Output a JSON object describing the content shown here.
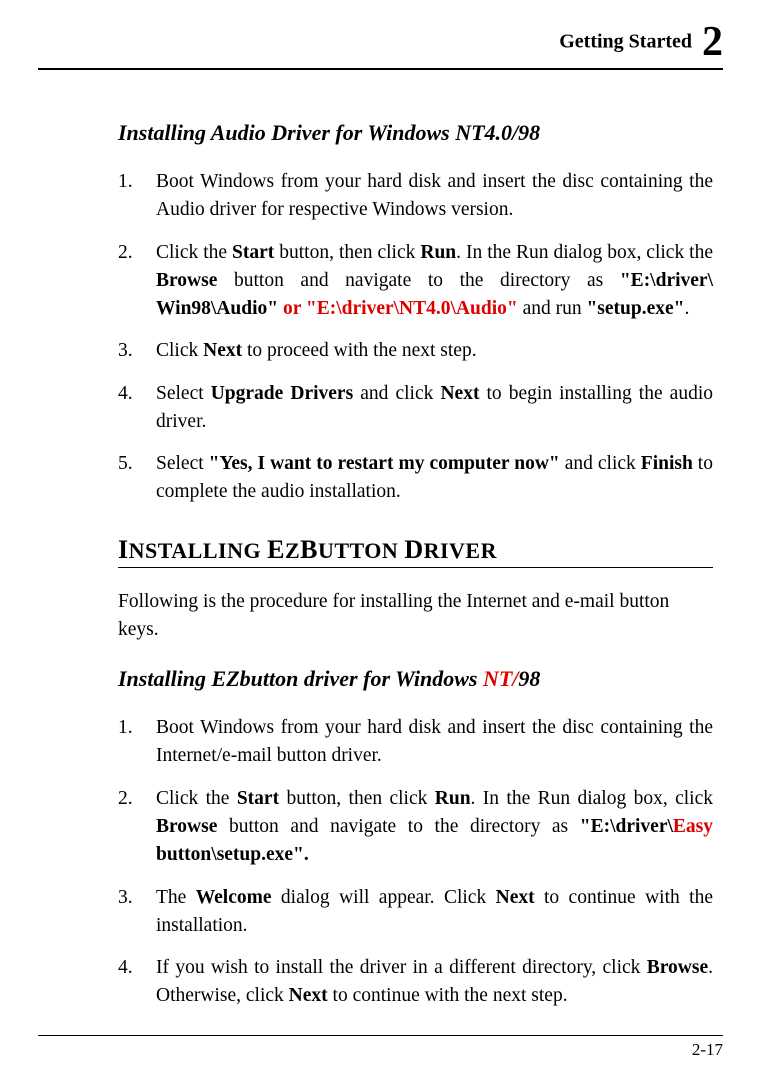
{
  "header": {
    "label": "Getting Started",
    "chapter": "2"
  },
  "sectionA": {
    "title_pre": "Installing Audio Driver for Windows NT4.0/",
    "title_red": "",
    "title_post": "98",
    "items": [
      {
        "parts": [
          {
            "t": "Boot Windows from your hard disk and insert the disc containing the Audio driver for respective Windows version."
          }
        ]
      },
      {
        "parts": [
          {
            "t": "Click the "
          },
          {
            "t": "Start",
            "b": true
          },
          {
            "t": " button, then click "
          },
          {
            "t": "Run",
            "b": true
          },
          {
            "t": ". In the Run dialog box, click the "
          },
          {
            "t": "Browse",
            "b": true
          },
          {
            "t": " button and navigate to the directory as "
          },
          {
            "t": "\"E:\\driver\\ Win98\\Audio\"",
            "b": true
          },
          {
            "t": " "
          },
          {
            "t": "or \"E:\\driver\\NT4.0\\Audio\"",
            "b": true,
            "red": true
          },
          {
            "t": " and run "
          },
          {
            "t": "\"setup.exe\"",
            "b": true
          },
          {
            "t": "."
          }
        ]
      },
      {
        "parts": [
          {
            "t": "Click "
          },
          {
            "t": "Next",
            "b": true
          },
          {
            "t": " to proceed with the next step."
          }
        ]
      },
      {
        "parts": [
          {
            "t": "Select "
          },
          {
            "t": "Upgrade Drivers",
            "b": true
          },
          {
            "t": " and click "
          },
          {
            "t": "Next",
            "b": true
          },
          {
            "t": " to begin installing the audio driver."
          }
        ]
      },
      {
        "parts": [
          {
            "t": "Select "
          },
          {
            "t": "\"Yes, I want to restart my computer now\"",
            "b": true
          },
          {
            "t": " and click "
          },
          {
            "t": "Finish",
            "b": true
          },
          {
            "t": " to complete the audio installation."
          }
        ]
      }
    ]
  },
  "sectionB": {
    "heading": "Installing EzButton Driver",
    "intro": "Following is the procedure for installing the Internet and e-mail button keys.",
    "sub_pre": "Installing EZbutton driver for Windows ",
    "sub_red": "NT/",
    "sub_post": "98",
    "items": [
      {
        "parts": [
          {
            "t": "Boot Windows from your hard disk and insert the disc containing the Internet/e-mail button driver."
          }
        ]
      },
      {
        "parts": [
          {
            "t": "Click the "
          },
          {
            "t": "Start",
            "b": true
          },
          {
            "t": " button, then click "
          },
          {
            "t": "Run",
            "b": true
          },
          {
            "t": ". In the Run dialog box, click "
          },
          {
            "t": "Browse",
            "b": true
          },
          {
            "t": " button and navigate to the directory as "
          },
          {
            "t": "\"E:\\driver\\",
            "b": true
          },
          {
            "t": "Easy",
            "b": true,
            "red": true
          },
          {
            "t": " button\\setup.exe\".",
            "b": true
          }
        ]
      },
      {
        "parts": [
          {
            "t": "The "
          },
          {
            "t": "Welcome",
            "b": true
          },
          {
            "t": " dialog will appear. Click "
          },
          {
            "t": "Next",
            "b": true
          },
          {
            "t": " to continue with the installation."
          }
        ]
      },
      {
        "parts": [
          {
            "t": "If you wish to install the driver in a different directory, click "
          },
          {
            "t": "Browse",
            "b": true
          },
          {
            "t": ". Otherwise, click "
          },
          {
            "t": "Next",
            "b": true
          },
          {
            "t": " to continue with the next step."
          }
        ]
      }
    ]
  },
  "page": "2-17"
}
